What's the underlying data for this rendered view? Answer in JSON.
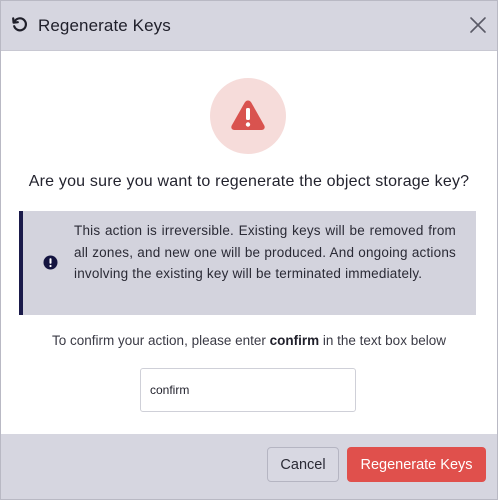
{
  "dialog": {
    "title": "Regenerate Keys",
    "title_icon": "rotate-ccw-icon",
    "close_icon": "close-icon"
  },
  "warning": {
    "icon": "warning-triangle-icon",
    "color": "#d9534f",
    "bg_color": "#f6dcda"
  },
  "question": "Are you sure you want to regenerate the object storage key?",
  "notice": {
    "icon": "info-circle-icon",
    "text": "This action is irreversible. Existing keys will be removed from all zones, and new one will be produced. And ongoing actions involving the existing key will be terminated immediately.",
    "border_color": "#1a1a4a"
  },
  "confirm": {
    "prefix": "To confirm your action, please enter ",
    "keyword": "confirm",
    "suffix": " in the text box below",
    "input_value": "confirm"
  },
  "footer": {
    "cancel_label": "Cancel",
    "regenerate_label": "Regenerate Keys",
    "accent_color": "#e0504c"
  }
}
